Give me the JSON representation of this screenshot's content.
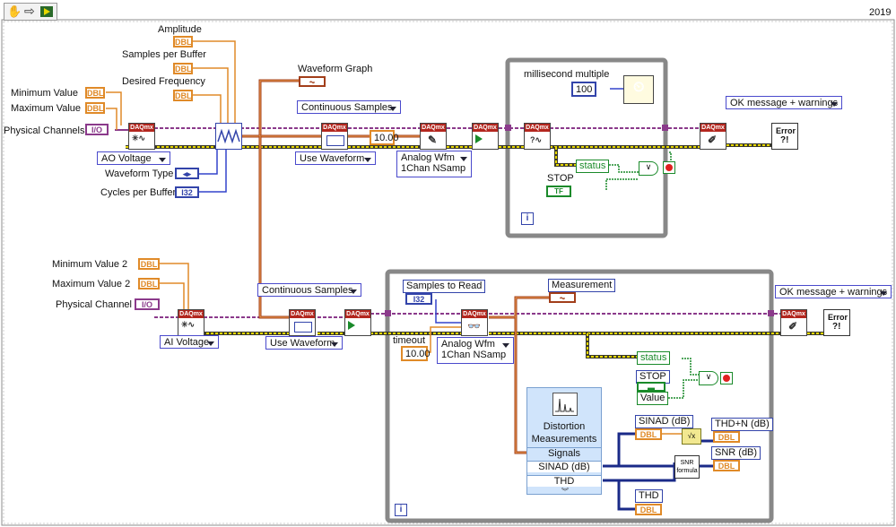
{
  "window": {
    "version": "2019"
  },
  "toolbar": {
    "hand_icon": "hand-icon",
    "arrow_icon": "arrow-icon",
    "run_icon": "run-icon"
  },
  "controls": {
    "amplitude": "Amplitude",
    "samples_per_buffer": "Samples per Buffer",
    "desired_frequency": "Desired Frequency",
    "minimum_value": "Minimum Value",
    "maximum_value": "Maximum Value",
    "physical_channels": "Physical Channels",
    "waveform_type": "Waveform Type",
    "cycles_per_buffer": "Cycles per Buffer",
    "minimum_value_2": "Minimum Value 2",
    "maximum_value_2": "Maximum Value 2",
    "physical_channel": "Physical Channel",
    "samples_to_read": "Samples to Read",
    "timeout": "timeout"
  },
  "terminals": {
    "dbl": "DBL",
    "i32": "I32",
    "io": "I/O",
    "tf": "TF"
  },
  "indicators": {
    "waveform_graph": "Waveform Graph",
    "measurement": "Measurement",
    "sinad": "SINAD (dB)",
    "thdn": "THD+N (dB)",
    "snr": "SNR (dB)",
    "thd": "THD"
  },
  "enums": {
    "ao_voltage": "AO Voltage",
    "ai_voltage": "AI Voltage",
    "continuous_samples_1": "Continuous Samples",
    "continuous_samples_2": "Continuous Samples",
    "use_waveform_1": "Use Waveform",
    "use_waveform_2": "Use Waveform",
    "ok_message_1": "OK message + warnings",
    "ok_message_2": "OK message + warnings"
  },
  "polymorphic": {
    "write_line1": "Analog Wfm",
    "write_line2": "1Chan NSamp",
    "read_line1": "Analog Wfm",
    "read_line2": "1Chan NSamp"
  },
  "constants": {
    "timeout_write": "10.00",
    "timeout_read": "10.00",
    "wait_ms": "100"
  },
  "loop1": {
    "label": "millisecond multiple",
    "status": "status",
    "stop": "STOP",
    "iteration": "i"
  },
  "loop2": {
    "status": "status",
    "stop": "STOP",
    "value": "Value",
    "iteration": "i"
  },
  "express": {
    "title_line1": "Distortion",
    "title_line2": "Measurements",
    "rows": [
      "Signals",
      "SINAD (dB)",
      "THD"
    ]
  },
  "formula": {
    "snr_line1": "SNR",
    "snr_line2": "formula"
  },
  "vi_labels": {
    "daqmx": "DAQmx",
    "error": "Error"
  }
}
